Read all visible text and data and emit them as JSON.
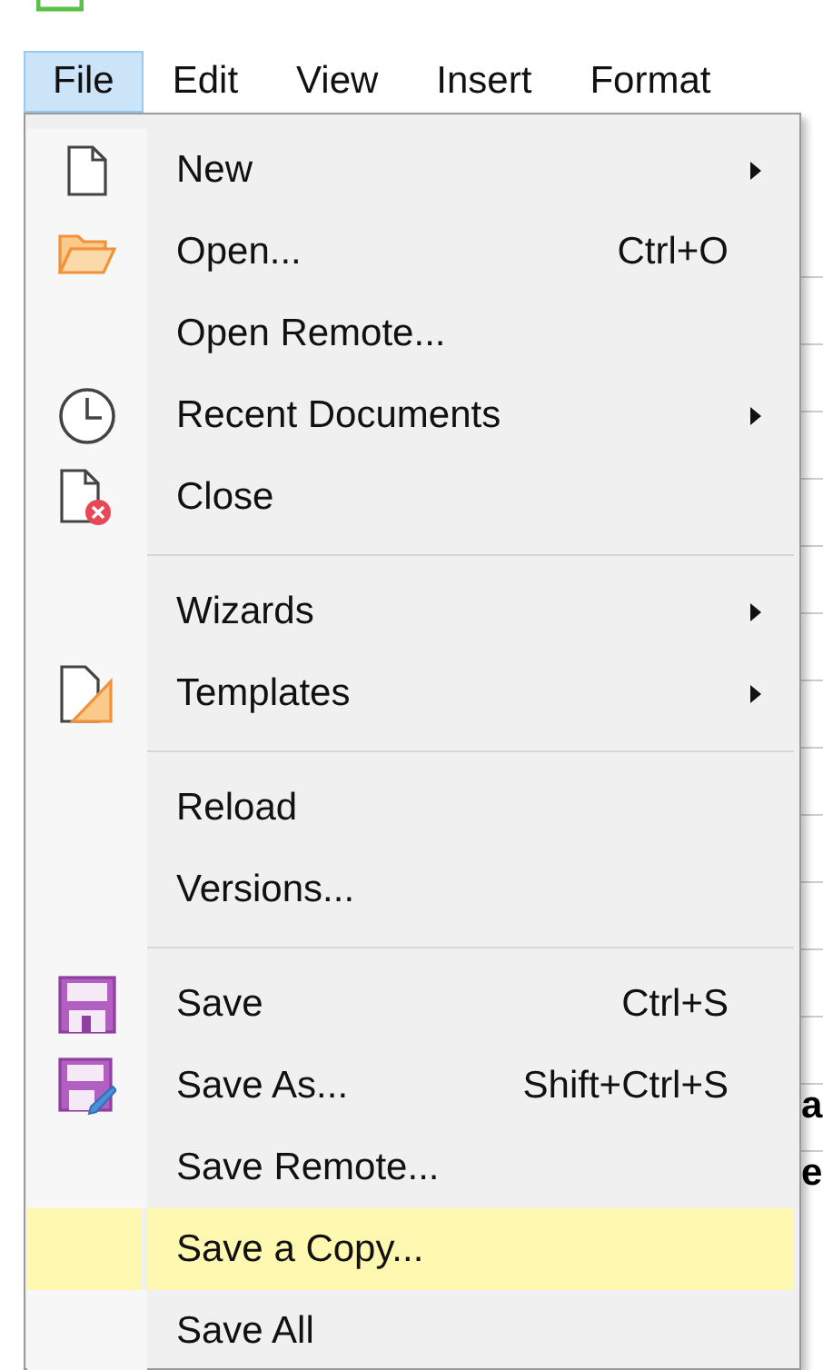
{
  "menubar": [
    {
      "label": "File",
      "selected": true
    },
    {
      "label": "Edit",
      "selected": false
    },
    {
      "label": "View",
      "selected": false
    },
    {
      "label": "Insert",
      "selected": false
    },
    {
      "label": "Format",
      "selected": false
    }
  ],
  "menu": [
    {
      "kind": "document",
      "label": "New",
      "submenu": true,
      "selected": false
    },
    {
      "kind": "folder",
      "label": "Open...",
      "shortcut": "Ctrl+O",
      "submenu": false,
      "selected": false
    },
    {
      "kind": "plain",
      "label": "Open Remote...",
      "submenu": false,
      "selected": false
    },
    {
      "kind": "clock",
      "label": "Recent Documents",
      "submenu": true,
      "selected": false
    },
    {
      "kind": "close",
      "label": "Close",
      "submenu": false,
      "selected": false
    },
    {
      "kind": "separator"
    },
    {
      "kind": "plain",
      "label": "Wizards",
      "submenu": true,
      "selected": false
    },
    {
      "kind": "template",
      "label": "Templates",
      "submenu": true,
      "selected": false
    },
    {
      "kind": "separator"
    },
    {
      "kind": "plain",
      "label": "Reload",
      "submenu": false,
      "selected": false
    },
    {
      "kind": "plain",
      "label": "Versions...",
      "submenu": false,
      "selected": false
    },
    {
      "kind": "separator"
    },
    {
      "kind": "save",
      "label": "Save",
      "shortcut": "Ctrl+S",
      "submenu": false,
      "selected": false
    },
    {
      "kind": "saveas",
      "label": "Save As...",
      "shortcut": "Shift+Ctrl+S",
      "submenu": false,
      "selected": false
    },
    {
      "kind": "plain",
      "label": "Save Remote...",
      "submenu": false,
      "selected": false
    },
    {
      "kind": "plain",
      "label": "Save a Copy...",
      "submenu": false,
      "selected": true
    },
    {
      "kind": "plain",
      "label": "Save All",
      "submenu": false,
      "selected": false
    }
  ],
  "background_text": [
    "a",
    "e"
  ]
}
